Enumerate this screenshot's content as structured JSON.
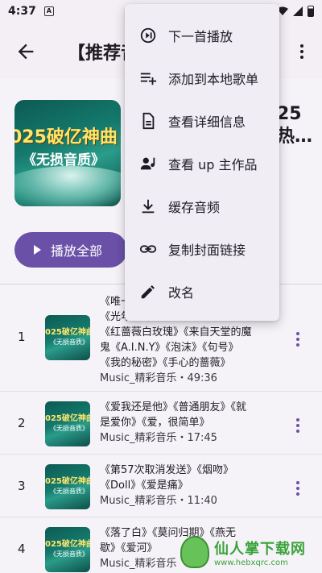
{
  "status_bar": {
    "time": "4:37",
    "notif_letter": "A"
  },
  "app_bar": {
    "title": "【推荐音"
  },
  "header": {
    "cover_text_line1": "025破亿神曲",
    "cover_text_line2": "《无损音质》",
    "side_title_line1": "25",
    "side_title_line2": "热…",
    "play_all_label": "播放全部"
  },
  "songs": [
    {
      "number": "1",
      "title_lines": [
        "《唯一》",
        "《光年之外》",
        "《红蔷薇白玫瑰》《来自天堂的魔",
        "鬼《A.I.N.Y》《泡沫》《句号》",
        "《我的秘密》《手心的蔷薇》"
      ],
      "meta": "Music_精彩音乐・49:36"
    },
    {
      "number": "2",
      "title_lines": [
        "《爱我还是他》《普通朋友》《就",
        "是爱你》《爱，很简单》"
      ],
      "meta": "Music_精彩音乐・17:45"
    },
    {
      "number": "3",
      "title_lines": [
        "《第57次取消发送》《烟吻》",
        "《Doll》《爱是痛》"
      ],
      "meta": "Music_精彩音乐・11:40"
    },
    {
      "number": "4",
      "title_lines": [
        "《落了白》《莫问归期》《燕无",
        "歇》《爱河》"
      ],
      "meta": "Music_精彩音乐"
    }
  ],
  "thumb_text": {
    "line1": "025破亿神曲",
    "line2": "《无损音质》"
  },
  "menu": {
    "items": [
      {
        "label": "下一首播放",
        "icon": "play-next-icon"
      },
      {
        "label": "添加到本地歌单",
        "icon": "playlist-add-icon"
      },
      {
        "label": "查看详细信息",
        "icon": "document-icon"
      },
      {
        "label": "查看 up 主作品",
        "icon": "person-music-icon"
      },
      {
        "label": "缓存音频",
        "icon": "download-icon"
      },
      {
        "label": "复制封面链接",
        "icon": "link-icon"
      },
      {
        "label": "改名",
        "icon": "edit-icon"
      }
    ]
  },
  "watermark": {
    "name": "仙人掌下载网",
    "url": "www.hebxqrc.com"
  },
  "colors": {
    "accent": "#6a50a7",
    "menu_bg": "#f1edf5",
    "background": "#f6f3f8"
  }
}
